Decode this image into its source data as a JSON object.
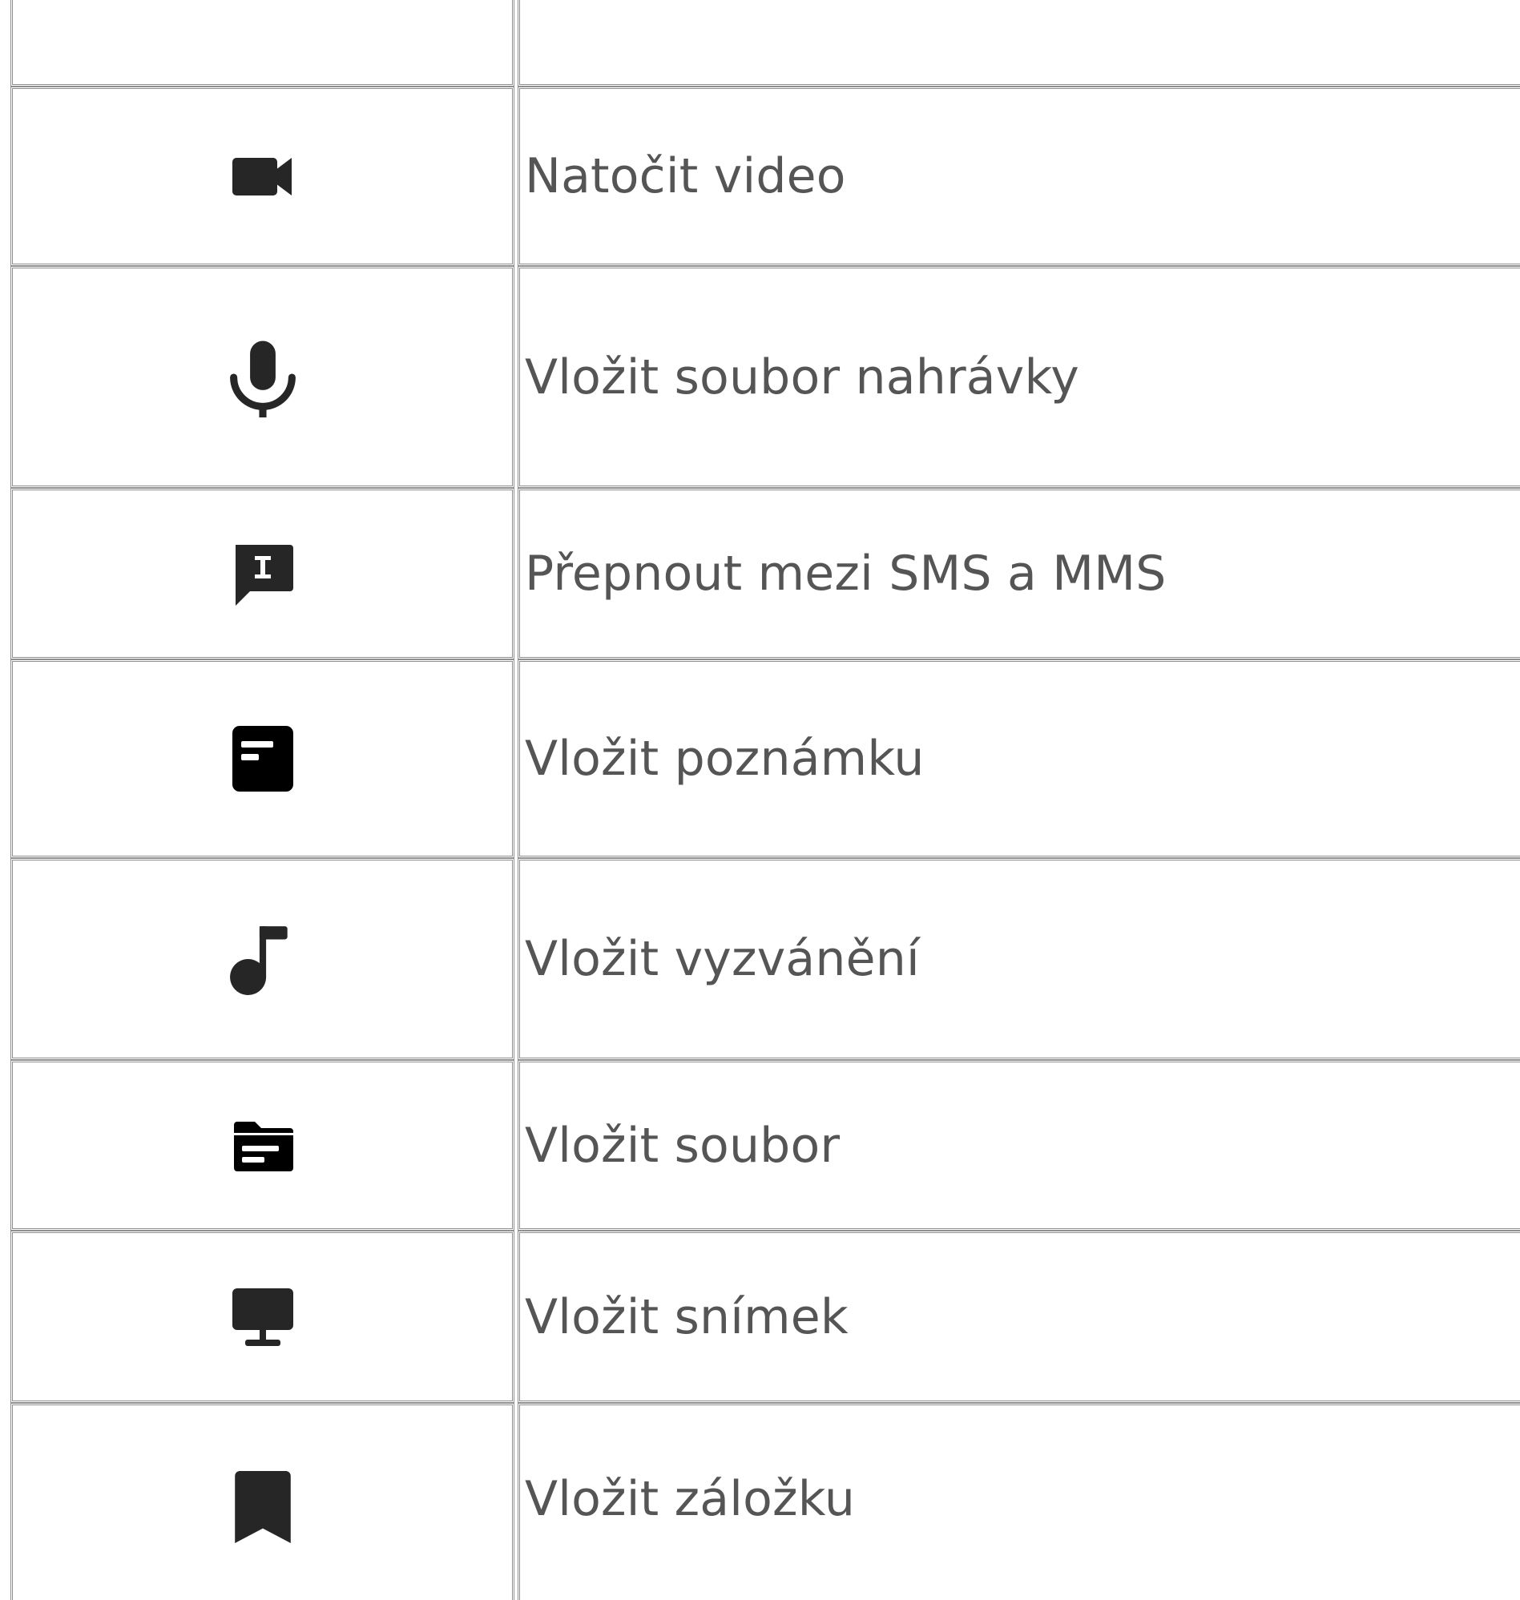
{
  "table": {
    "rows": [
      {
        "icon": "",
        "label": ""
      },
      {
        "icon": "video-camera-icon",
        "label": "Natočit video"
      },
      {
        "icon": "microphone-icon",
        "label": "Vložit soubor nahrávky"
      },
      {
        "icon": "sms-mms-message-icon",
        "label": "Přepnout mezi SMS a MMS"
      },
      {
        "icon": "note-icon",
        "label": "Vložit poznámku"
      },
      {
        "icon": "music-note-icon",
        "label": "Vložit vyzvánění"
      },
      {
        "icon": "folder-file-icon",
        "label": "Vložit soubor"
      },
      {
        "icon": "monitor-icon",
        "label": "Vložit snímek"
      },
      {
        "icon": "bookmark-icon",
        "label": "Vložit záložku"
      }
    ]
  },
  "colors": {
    "text": "#555555",
    "icon": "#2a2a2a",
    "border": "#8f8f8f"
  }
}
